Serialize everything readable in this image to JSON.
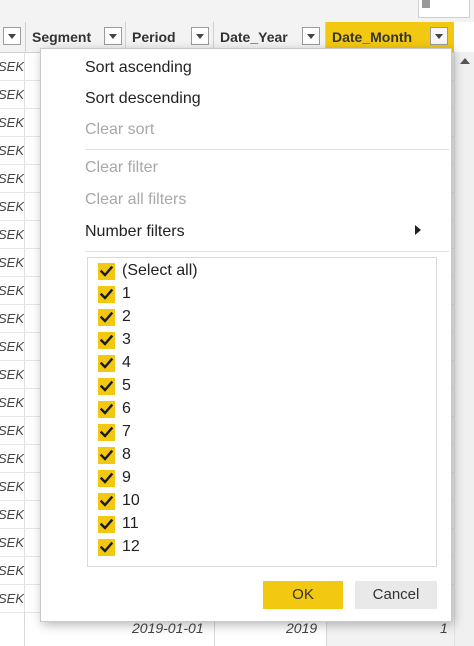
{
  "columns": [
    {
      "label": ""
    },
    {
      "label": "Segment"
    },
    {
      "label": "Period"
    },
    {
      "label": "Date_Year"
    },
    {
      "label": "Date_Month"
    }
  ],
  "row_stub_text": "SEK",
  "last_row": {
    "date": "2019-01-01",
    "year": "2019",
    "month": "1"
  },
  "menu": {
    "sort_ascending": "Sort ascending",
    "sort_descending": "Sort descending",
    "clear_sort": "Clear sort",
    "clear_filter": "Clear filter",
    "clear_all_filters": "Clear all filters",
    "number_filters": "Number filters"
  },
  "filter_options": [
    {
      "label": "(Select all)",
      "checked": true
    },
    {
      "label": "1",
      "checked": true
    },
    {
      "label": "2",
      "checked": true
    },
    {
      "label": "3",
      "checked": true
    },
    {
      "label": "4",
      "checked": true
    },
    {
      "label": "5",
      "checked": true
    },
    {
      "label": "6",
      "checked": true
    },
    {
      "label": "7",
      "checked": true
    },
    {
      "label": "8",
      "checked": true
    },
    {
      "label": "9",
      "checked": true
    },
    {
      "label": "10",
      "checked": true
    },
    {
      "label": "11",
      "checked": true
    },
    {
      "label": "12",
      "checked": true
    }
  ],
  "buttons": {
    "ok": "OK",
    "cancel": "Cancel"
  },
  "colors": {
    "accent": "#f2c811",
    "disabled_text": "#a8a8a8"
  }
}
